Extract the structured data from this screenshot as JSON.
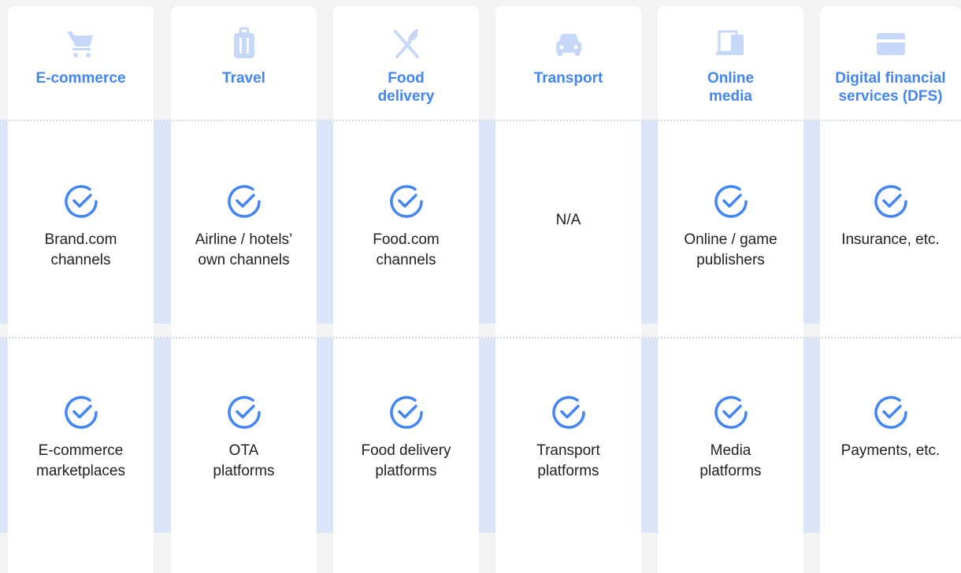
{
  "colors": {
    "accent": "#4285f4",
    "icon_light": "#c6d7f7",
    "band": "#dae5f8",
    "text": "#202124"
  },
  "columns": [
    {
      "title": "E-commerce",
      "icon": "shopping-cart-icon",
      "row1": {
        "checked": true,
        "label": "Brand.com\nchannels"
      },
      "row2": {
        "checked": true,
        "label": "E-commerce\nmarketplaces"
      }
    },
    {
      "title": "Travel",
      "icon": "luggage-icon",
      "row1": {
        "checked": true,
        "label": "Airline / hotels’\nown channels"
      },
      "row2": {
        "checked": true,
        "label": "OTA\nplatforms"
      }
    },
    {
      "title": "Food\ndelivery",
      "icon": "fork-knife-icon",
      "row1": {
        "checked": true,
        "label": "Food.com\nchannels"
      },
      "row2": {
        "checked": true,
        "label": "Food delivery\nplatforms"
      }
    },
    {
      "title": "Transport",
      "icon": "car-icon",
      "row1": {
        "checked": false,
        "label": "N/A"
      },
      "row2": {
        "checked": true,
        "label": "Transport\nplatforms"
      }
    },
    {
      "title": "Online\nmedia",
      "icon": "devices-icon",
      "row1": {
        "checked": true,
        "label": "Online / game\npublishers"
      },
      "row2": {
        "checked": true,
        "label": "Media\nplatforms"
      }
    },
    {
      "title": "Digital financial\nservices (DFS)",
      "icon": "credit-card-icon",
      "row1": {
        "checked": true,
        "label": "Insurance, etc."
      },
      "row2": {
        "checked": true,
        "label": "Payments, etc."
      }
    }
  ]
}
